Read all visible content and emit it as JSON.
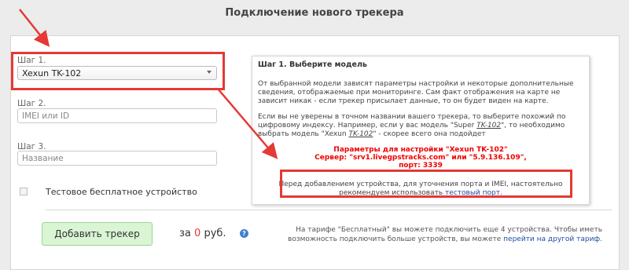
{
  "page_title": "Подключение нового трекера",
  "form": {
    "step1_label": "Шаг 1.",
    "step1_value": "Xexun TK-102",
    "step2_label": "Шаг 2.",
    "step2_placeholder": "IMEI или ID",
    "step3_label": "Шаг 3.",
    "step3_placeholder": "Название",
    "test_device_label": "Тестовое бесплатное устройство",
    "add_button": "Добавить трекер",
    "price_prefix": "за",
    "price_value": "0",
    "price_suffix": "руб.",
    "help_icon": "?"
  },
  "tariff": {
    "text": "На тарифе \"Бесплатный\" вы можете подключить еще 4 устройства. Чтобы иметь возможность подключить больше устройств, вы можете",
    "link": "перейти на другой тариф",
    "end": "."
  },
  "info": {
    "title": "Шаг 1. Выберите модель",
    "p1": "От выбранной модели зависят параметры настройки и некоторые дополнительные сведения, отображаемые при мониторинге. Сам факт отображения на карте не зависит никак - если трекер присылает данные, то он будет виден на карте.",
    "p2_a": "Если вы не уверены в точном названии вашего трекера, то выберите похожий по цифровому индексу. Например, если у вас модель \"Super",
    "p2_i1": "TK-102",
    "p2_b": "\", то необходимо выбрать модель \"Xexun",
    "p2_i2": "TK-102",
    "p2_c": "\" - скорее всего она подойдет",
    "red_line1": "Параметры для настройки \"Xexun TK-102\"",
    "red_line2": "Сервер: \"srv1.livegpstracks.com\" или \"5.9.136.109\",",
    "red_line3": "порт: 3339",
    "note": "Перед добавлением устройства, для уточнения порта и IMEI, настоятельно рекомендуем использовать",
    "note_link": "тестовый порт",
    "note_end": "."
  },
  "colors": {
    "annotation_red": "#e53935",
    "button_green": "#d9f5d4",
    "link_blue": "#1a4fa3"
  }
}
